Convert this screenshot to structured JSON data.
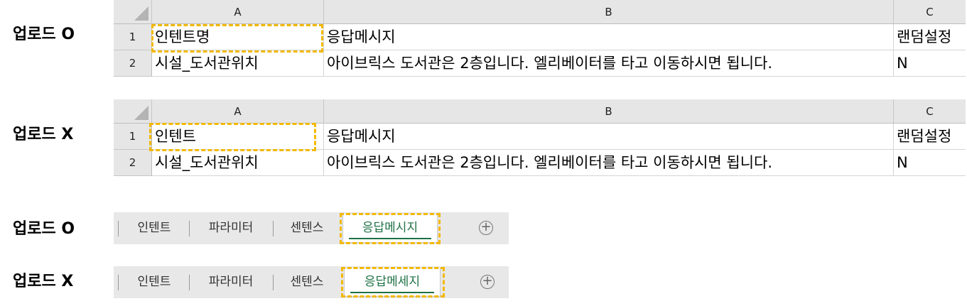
{
  "upload_ok": "업로드 O",
  "upload_no": "업로드 X",
  "columns": [
    "A",
    "B",
    "C"
  ],
  "row_numbers": [
    "1",
    "2"
  ],
  "sheet1": {
    "header_a": "인텐트명",
    "header_b": "응답메시지",
    "header_c": "랜덤설정",
    "row2_a": "시설_도서관위치",
    "row2_b": "아이브릭스 도서관은 2층입니다. 엘리베이터를 타고 이동하시면 됩니다.",
    "row2_c": "N"
  },
  "sheet2": {
    "header_a": "인텐트",
    "header_b": "응답메시지",
    "header_c": "랜덤설정",
    "row2_a": "시설_도서관위치",
    "row2_b": "아이브릭스 도서관은 2층입니다. 엘리베이터를 타고 이동하시면 됩니다.",
    "row2_c": "N"
  },
  "tabs1": [
    "인텐트",
    "파라미터",
    "센텐스",
    "응답메시지"
  ],
  "tabs2": [
    "인텐트",
    "파라미터",
    "센텐스",
    "응답메세지"
  ],
  "add_sheet_icon": "plus-circle-icon",
  "colors": {
    "highlight": "#f2b800",
    "active_tab_text": "#1e7145",
    "header_bg": "#e6e6e6"
  }
}
